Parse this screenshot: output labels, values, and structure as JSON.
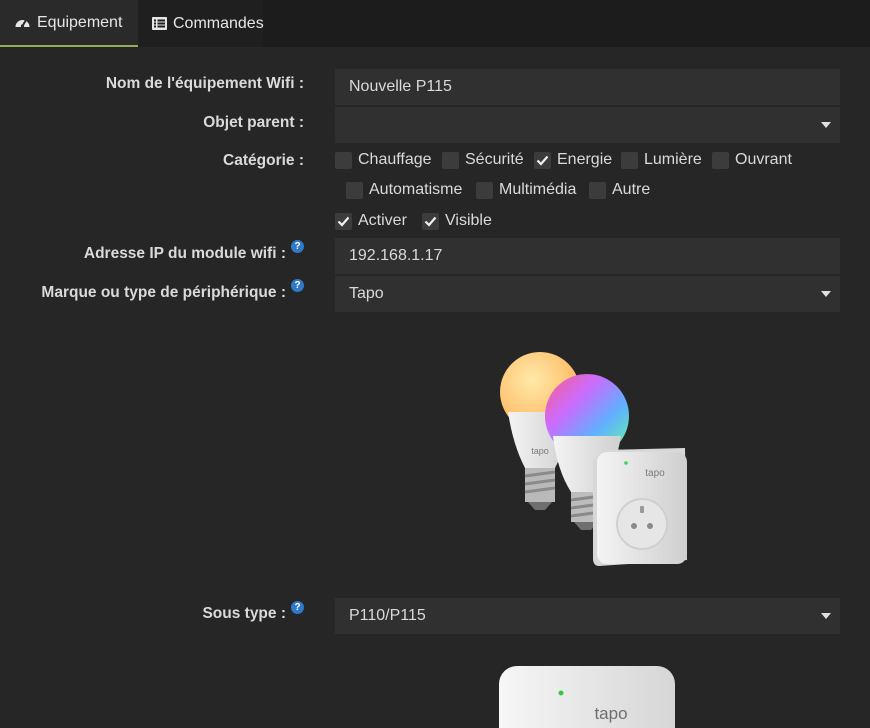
{
  "tabs": [
    {
      "label": "Equipement",
      "icon": "tachometer-icon",
      "active": true
    },
    {
      "label": "Commandes",
      "icon": "list-icon",
      "active": false
    }
  ],
  "form": {
    "name": {
      "label": "Nom de l'équipement Wifi :",
      "value": "Nouvelle P115"
    },
    "parent": {
      "label": "Objet parent :",
      "value": ""
    },
    "category": {
      "label": "Catégorie :",
      "options": [
        {
          "label": "Chauffage",
          "checked": false
        },
        {
          "label": "Sécurité",
          "checked": false
        },
        {
          "label": "Energie",
          "checked": true
        },
        {
          "label": "Lumière",
          "checked": false
        },
        {
          "label": "Ouvrant",
          "checked": false
        },
        {
          "label": "Automatisme",
          "checked": false
        },
        {
          "label": "Multimédia",
          "checked": false
        },
        {
          "label": "Autre",
          "checked": false
        }
      ]
    },
    "flags": [
      {
        "label": "Activer",
        "checked": true
      },
      {
        "label": "Visible",
        "checked": true
      }
    ],
    "ip": {
      "label": "Adresse IP du module wifi :",
      "value": "192.168.1.17"
    },
    "brand": {
      "label": "Marque ou type de périphérique :",
      "value": "Tapo"
    },
    "subtype": {
      "label": "Sous type :",
      "value": "P110/P115"
    },
    "help_glyph": "?"
  },
  "images": {
    "brand_brand_text": "tapo",
    "product_brand_text": "tapo"
  },
  "colors": {
    "accent": "#8fae5a",
    "help": "#2f79c9",
    "background": "#262626",
    "field": "#303030"
  }
}
